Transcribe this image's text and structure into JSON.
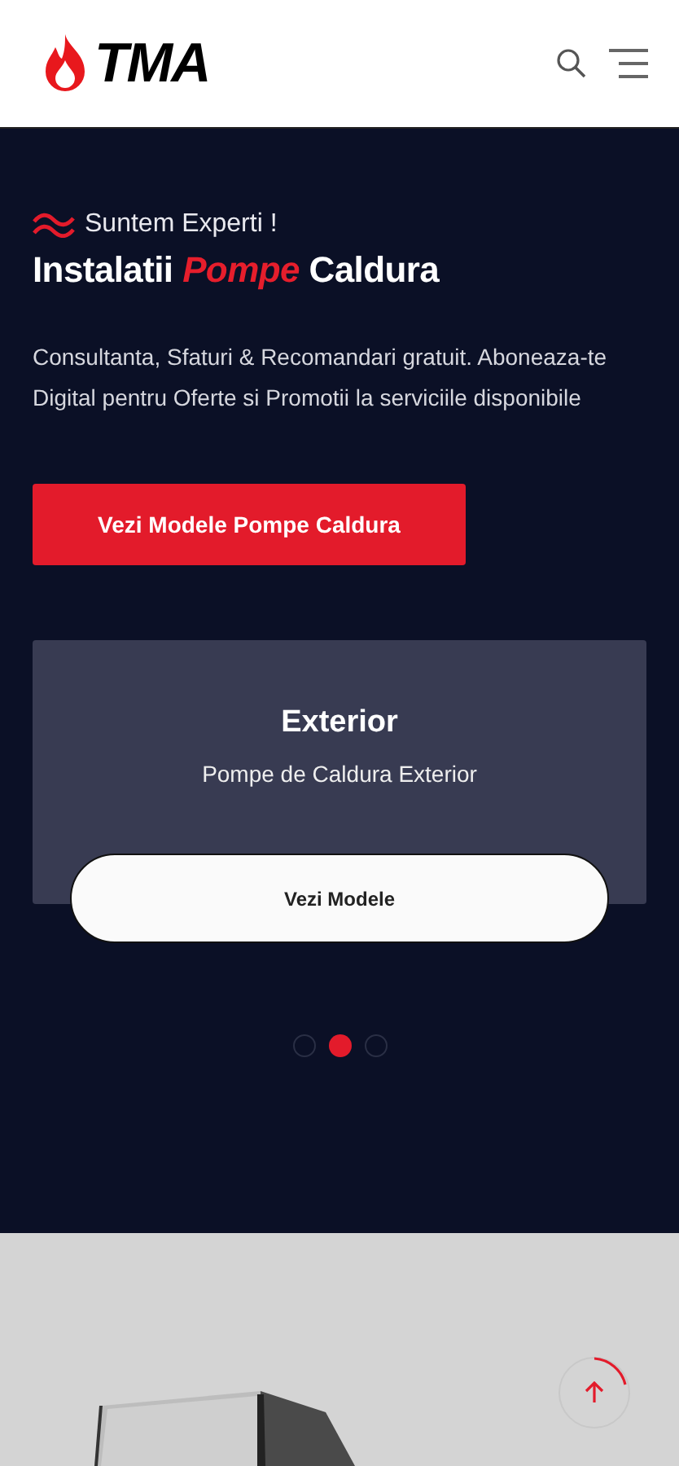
{
  "header": {
    "logo": "TMA"
  },
  "hero": {
    "eyebrow": "Suntem Experti !",
    "title": "Instalatii *Pompe* Caldura",
    "description": "Consultanta, Sfaturi & Recomandari gratuit. Aboneaza-te Digital pentru Oferte si Promotii la serviciile disponibile",
    "cta": "Vezi Modele Pompe Caldura"
  },
  "slide": {
    "title": "Exterior",
    "subtitle": "Pompe de Caldura Exterior",
    "button": "Vezi Modele"
  },
  "dots": [
    {
      "selected": false
    },
    {
      "selected": true
    },
    {
      "selected": false
    }
  ]
}
